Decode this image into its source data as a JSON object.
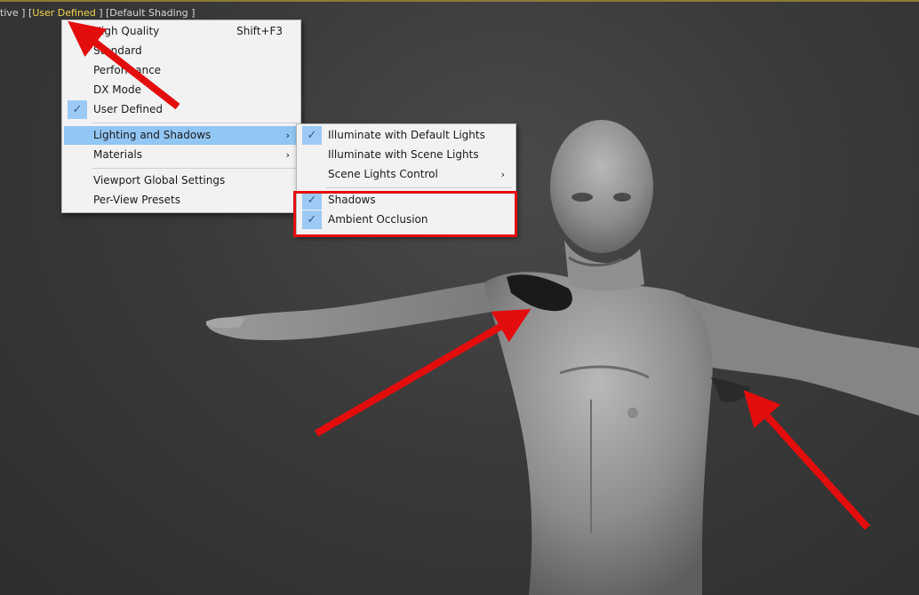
{
  "viewport_label": {
    "part1": "tive ]",
    "part2": "[",
    "preset": "User Defined",
    "part3": "] [Default Shading ]"
  },
  "main_menu": {
    "items": [
      {
        "label": "High Quality",
        "shortcut": "Shift+F3",
        "checked": false
      },
      {
        "label": "Standard",
        "checked": false
      },
      {
        "label": "Performance",
        "checked": false
      },
      {
        "label": "DX Mode",
        "checked": false
      },
      {
        "label": "User Defined",
        "checked": true
      },
      {
        "label": "Lighting and Shadows",
        "submenu": true,
        "active": true
      },
      {
        "label": "Materials",
        "submenu": true
      },
      {
        "label": "Viewport Global Settings"
      },
      {
        "label": "Per-View Presets"
      }
    ],
    "arrow_glyph": "›"
  },
  "sub_menu": {
    "items": [
      {
        "label": "Illuminate with Default Lights",
        "checked": true
      },
      {
        "label": "Illuminate with Scene Lights",
        "checked": false
      },
      {
        "label": "Scene Lights Control",
        "submenu": true
      },
      {
        "label": "Shadows",
        "checked": true
      },
      {
        "label": "Ambient Occlusion",
        "checked": true
      }
    ]
  },
  "check_glyph": "✓",
  "colors": {
    "accent_highlight": "#92c6f5",
    "annotation_red": "#e30d0d",
    "preset_yellow": "#f1d44b"
  }
}
